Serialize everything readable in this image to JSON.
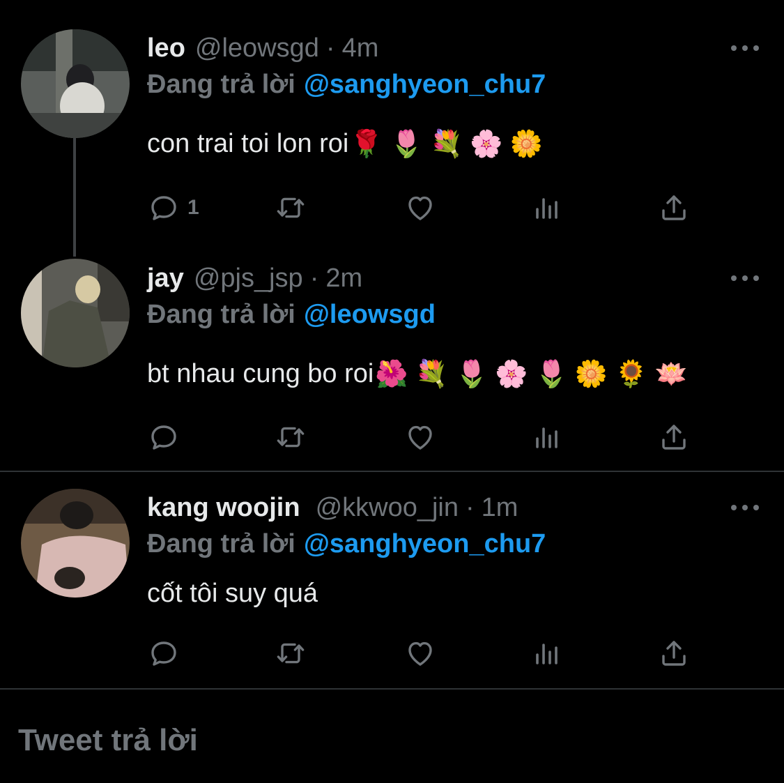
{
  "tweets": [
    {
      "name": "leo",
      "handle": "@leowsgd",
      "time": "4m",
      "reply_prefix": "Đang trả lời",
      "reply_target": "@sanghyeon_chu7",
      "body": "con trai toi lon roi",
      "emojis": "🌹🌷💐🌸🌼",
      "reply_count": "1"
    },
    {
      "name": "jay",
      "handle": "@pjs_jsp",
      "time": "2m",
      "reply_prefix": "Đang trả lời",
      "reply_target": "@leowsgd",
      "body": "bt nhau cung bo roi",
      "emojis": "🌺💐🌷🌸🌷🌼🌻🪷",
      "reply_count": ""
    },
    {
      "name": "kang woojin",
      "handle": "@kkwoo_jin",
      "time": "1m",
      "reply_prefix": "Đang trả lời",
      "reply_target": "@sanghyeon_chu7",
      "body": "cốt tôi suy quá",
      "emojis": "",
      "reply_count": ""
    }
  ],
  "separator": "·",
  "compose": {
    "placeholder": "Tweet trả lời"
  },
  "icons": [
    "reply-icon",
    "retweet-icon",
    "like-icon",
    "analytics-icon",
    "share-icon",
    "more-icon"
  ],
  "colors": {
    "background": "#000000",
    "text": "#e7e9ea",
    "muted": "#71767b",
    "link": "#1d9bf0",
    "divider": "#2f3336"
  }
}
